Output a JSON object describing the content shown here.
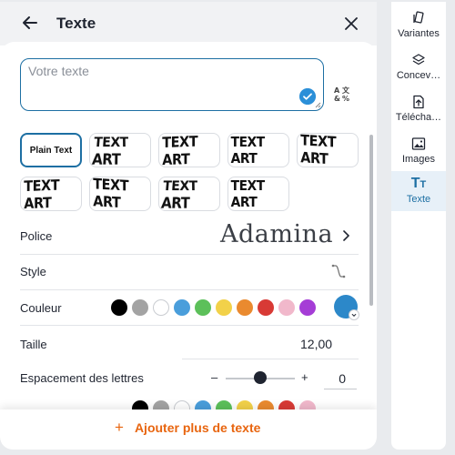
{
  "header": {
    "title": "Texte"
  },
  "text_input": {
    "placeholder": "Votre texte",
    "value": ""
  },
  "style_tiles": [
    {
      "label": "Plain Text",
      "selected": true
    },
    {
      "label": "TEXT ART"
    },
    {
      "label": "TEXT ART"
    },
    {
      "label": "TEXT ART"
    },
    {
      "label": "TEXT ART"
    },
    {
      "label": "TEXT ART"
    },
    {
      "label": "TEXT ART"
    },
    {
      "label": "TEXT ART"
    },
    {
      "label": "TEXT ART"
    }
  ],
  "rows": {
    "font_label": "Police",
    "font_value": "Adamina",
    "style_label": "Style",
    "color_label": "Couleur",
    "size_label": "Taille",
    "size_value": "12,00",
    "spacing_label": "Espacement des lettres",
    "spacing_minus": "–",
    "spacing_plus": "+",
    "spacing_value": "0"
  },
  "colors": [
    "#000000",
    "#a3a3a3",
    "#ffffff",
    "#4a9edb",
    "#5cc05a",
    "#f2d149",
    "#ea8a2f",
    "#d83a35",
    "#f1b8cb",
    "#a53dd6"
  ],
  "selected_color": "#2c88c9",
  "spacing_level": 0.5,
  "footer": {
    "add_label": "Ajouter plus de texte"
  },
  "sidenav": {
    "items": [
      {
        "label": "Variantes",
        "icon": "variants-icon"
      },
      {
        "label": "Concev…",
        "icon": "layers-icon"
      },
      {
        "label": "Télécha…",
        "icon": "upload-icon"
      },
      {
        "label": "Images",
        "icon": "image-icon"
      },
      {
        "label": "Texte",
        "icon": "text-icon",
        "active": true
      }
    ]
  }
}
